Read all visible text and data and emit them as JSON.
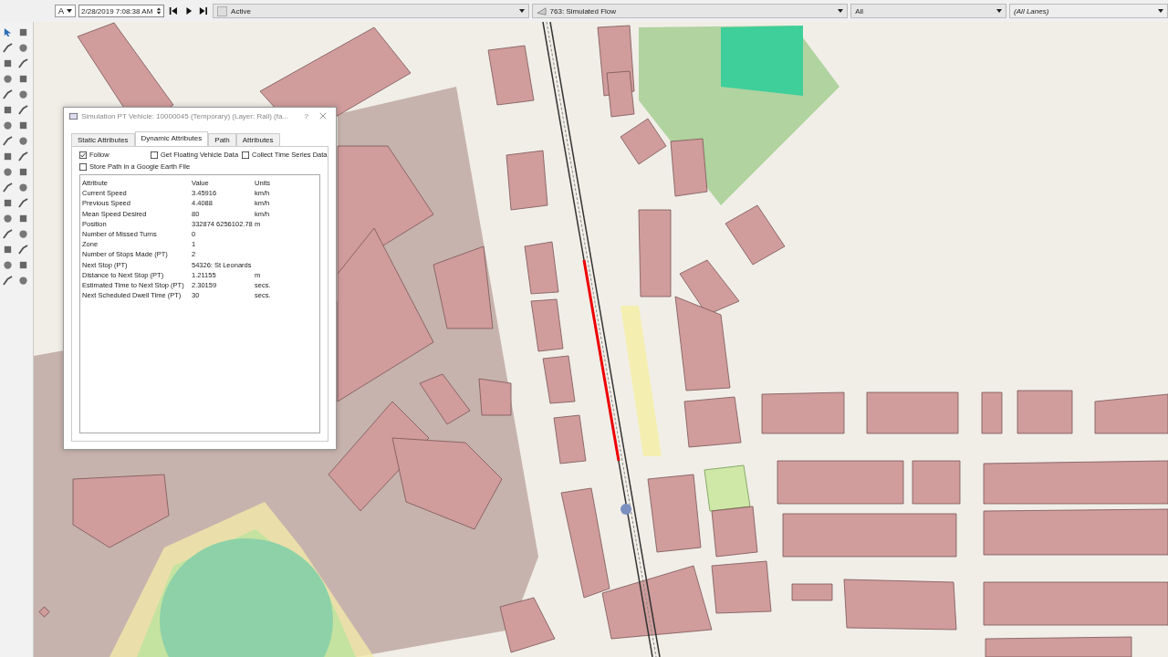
{
  "toolbar": {
    "lane_mode": "A",
    "datetime": "2/28/2019 7:08:38 AM",
    "filter": "Active",
    "flow": "763: Simulated Flow",
    "selection": "All",
    "lanes": "(All Lanes)"
  },
  "dialog": {
    "title": "Simulation PT Vehicle: 10000045 (Temporary) (Layer: Rail) (fa...",
    "help": "?",
    "tabs": [
      {
        "label": "Static Attributes",
        "selected": false
      },
      {
        "label": "Dynamic Attributes",
        "selected": true
      },
      {
        "label": "Path",
        "selected": false
      },
      {
        "label": "Attributes",
        "selected": false
      }
    ],
    "checkboxes": [
      {
        "label": "Follow",
        "checked": true
      },
      {
        "label": "Get Floating Vehicle Data",
        "checked": false
      },
      {
        "label": "Collect Time Series Data",
        "checked": false
      },
      {
        "label": "Store Path in a Google Earth File",
        "checked": false
      }
    ],
    "table": {
      "columns": [
        "Attribute",
        "Value",
        "Units"
      ],
      "rows": [
        [
          "Current Speed",
          "3.45916",
          "km/h"
        ],
        [
          "Previous Speed",
          "4.4088",
          "km/h"
        ],
        [
          "Mean Speed Desired",
          "80",
          "km/h"
        ],
        [
          "Position",
          "332874 6256102.78",
          "m"
        ],
        [
          "Number of Missed Turns",
          "0",
          ""
        ],
        [
          "Zone",
          "1",
          ""
        ],
        [
          "Number of Stops Made (PT)",
          "2",
          ""
        ],
        [
          "Next Stop (PT)",
          "54326: St Leonards",
          ""
        ],
        [
          "Distance to Next Stop (PT)",
          "1.21155",
          "m"
        ],
        [
          "Estimated Time to Next Stop (PT)",
          "2.30159",
          "secs."
        ],
        [
          "Next Scheduled Dwell Time (PT)",
          "30",
          "secs."
        ]
      ]
    }
  }
}
